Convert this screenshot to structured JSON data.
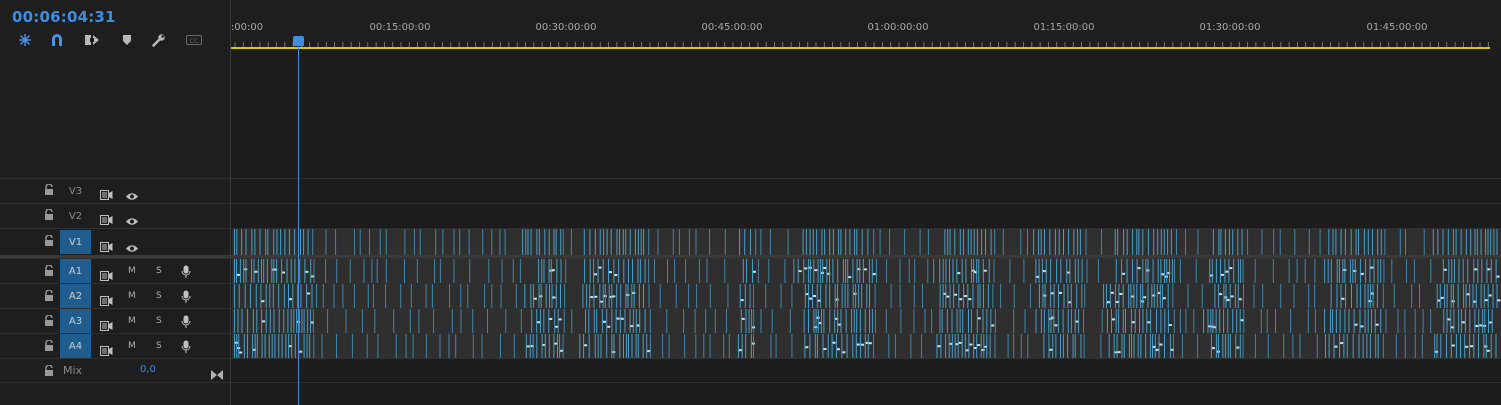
{
  "timecode": "00:06:04:31",
  "toolbar": [
    {
      "name": "snap-nested-icon"
    },
    {
      "name": "snap-magnet-icon"
    },
    {
      "name": "linked-selection-icon"
    },
    {
      "name": "add-marker-icon"
    },
    {
      "name": "wrench-icon"
    },
    {
      "name": "captions-icon"
    }
  ],
  "ruler": {
    "labels": [
      ":00:00",
      "00:15:00:00",
      "00:30:00:00",
      "00:45:00:00",
      "01:00:00:00",
      "01:15:00:00",
      "01:30:00:00",
      "01:45:00:00"
    ]
  },
  "tracks": {
    "video": [
      {
        "name": "V3",
        "targeted": false
      },
      {
        "name": "V2",
        "targeted": false
      },
      {
        "name": "V1",
        "targeted": true
      }
    ],
    "audio": [
      {
        "name": "A1",
        "targeted": true,
        "m": "M",
        "s": "S"
      },
      {
        "name": "A2",
        "targeted": true,
        "m": "M",
        "s": "S"
      },
      {
        "name": "A3",
        "targeted": true,
        "m": "M",
        "s": "S"
      },
      {
        "name": "A4",
        "targeted": true,
        "m": "M",
        "s": "S"
      }
    ],
    "mix": {
      "label": "Mix",
      "value": "0,0"
    }
  },
  "colors": {
    "accent": "#3d8ee3",
    "clip": "#4aa3cf",
    "work_area": "#d8c70c",
    "target": "#1f5d8e"
  }
}
